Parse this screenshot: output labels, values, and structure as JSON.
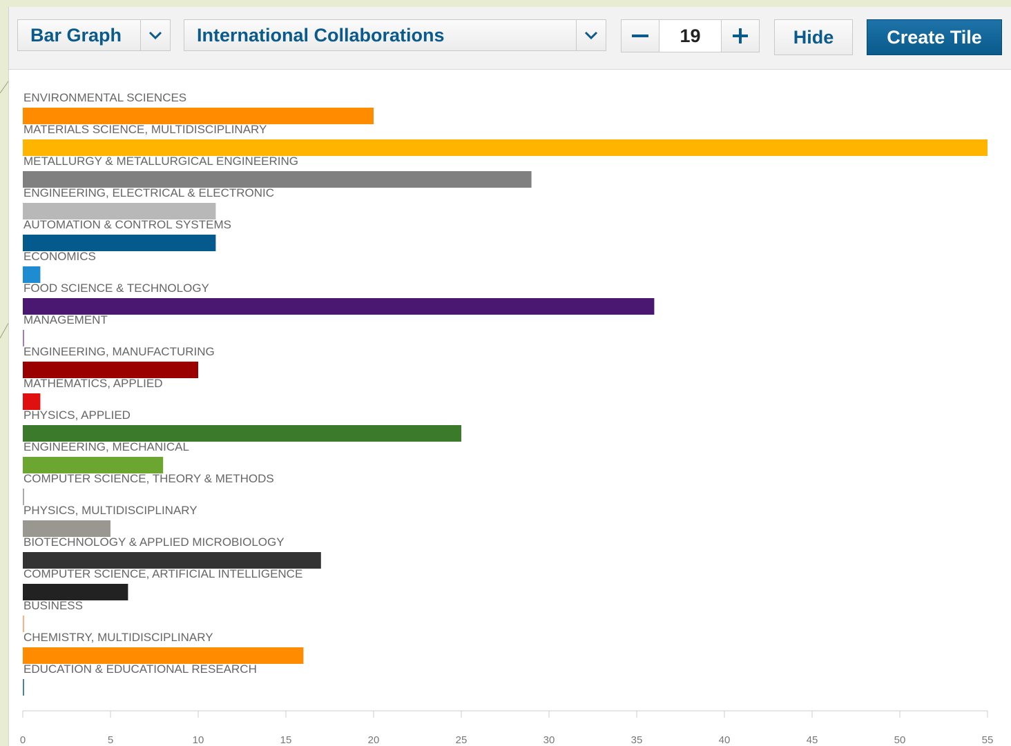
{
  "toolbar": {
    "chart_type_label": "Bar Graph",
    "metric_label": "International Collaborations",
    "count_value": "19",
    "hide_label": "Hide",
    "create_tile_label": "Create Tile",
    "icons": {
      "chart_type_caret": "chevron-down-icon",
      "metric_caret": "chevron-down-icon",
      "decrement": "minus-icon",
      "increment": "plus-icon"
    },
    "accent_color": "#0a5a8c"
  },
  "chart_data": {
    "type": "bar",
    "orientation": "horizontal",
    "categories": [
      "ENVIRONMENTAL SCIENCES",
      "MATERIALS SCIENCE, MULTIDISCIPLINARY",
      "METALLURGY & METALLURGICAL ENGINEERING",
      "ENGINEERING, ELECTRICAL & ELECTRONIC",
      "AUTOMATION & CONTROL SYSTEMS",
      "ECONOMICS",
      "FOOD SCIENCE & TECHNOLOGY",
      "MANAGEMENT",
      "ENGINEERING, MANUFACTURING",
      "MATHEMATICS, APPLIED",
      "PHYSICS, APPLIED",
      "ENGINEERING, MECHANICAL",
      "COMPUTER SCIENCE, THEORY & METHODS",
      "PHYSICS, MULTIDISCIPLINARY",
      "BIOTECHNOLOGY & APPLIED MICROBIOLOGY",
      "COMPUTER SCIENCE, ARTIFICIAL INTELLIGENCE",
      "BUSINESS",
      "CHEMISTRY, MULTIDISCIPLINARY",
      "EDUCATION & EDUCATIONAL RESEARCH"
    ],
    "values": [
      20,
      55,
      29,
      11,
      11,
      1,
      36,
      0,
      10,
      1,
      25,
      8,
      0,
      5,
      17,
      6,
      0,
      16,
      0
    ],
    "colors": [
      "#ff8c00",
      "#ffb400",
      "#808080",
      "#b8b8b8",
      "#045a8d",
      "#1d8cd0",
      "#4a1870",
      "#9d7cd0",
      "#9b0000",
      "#e01010",
      "#3a7a2a",
      "#6aa630",
      "#aaaaaa",
      "#9a9690",
      "#333333",
      "#222222",
      "#ffb080",
      "#ff8c00",
      "#4682b4"
    ],
    "xlim": [
      0,
      55
    ],
    "xticks": [
      0,
      5,
      10,
      15,
      20,
      25,
      30,
      35,
      40,
      45,
      50,
      55
    ],
    "title": "",
    "xlabel": "",
    "ylabel": "",
    "grid": false
  }
}
